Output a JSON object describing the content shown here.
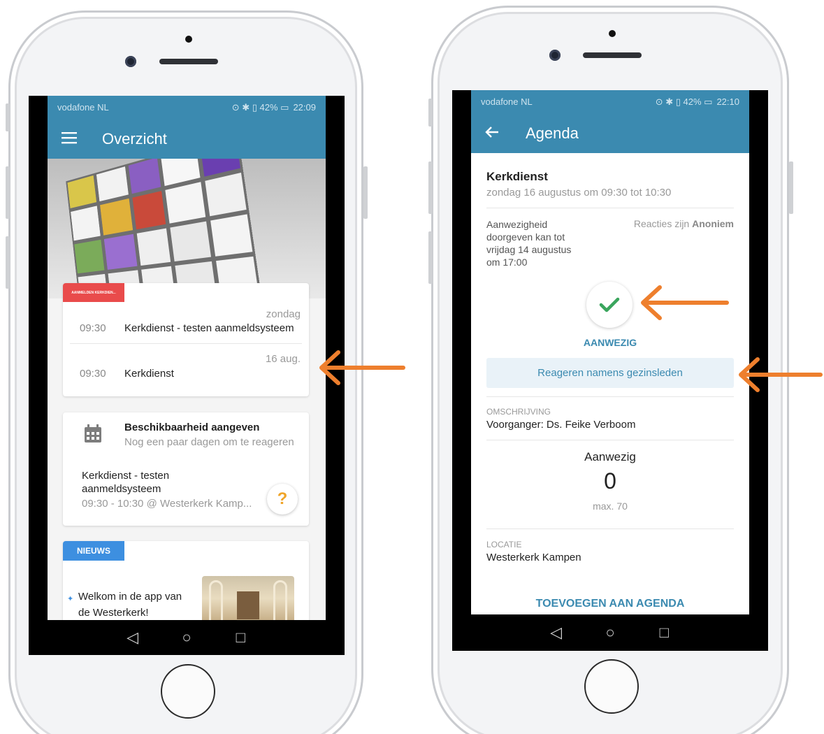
{
  "left_phone": {
    "status": {
      "carrier": "vodafone NL",
      "icons": "⊙ ✱ ▯ 42% ▭",
      "time": "22:09"
    },
    "appbar": {
      "menu_icon": "menu-icon",
      "title": "Overzicht"
    },
    "event_card": {
      "tag": "AANMELDEN KERKDIEN...",
      "rows": [
        {
          "date": "zondag",
          "time": "09:30",
          "title": "Kerkdienst - testen aanmeldsysteem"
        },
        {
          "date": "16 aug.",
          "time": "09:30",
          "title": "Kerkdienst"
        }
      ]
    },
    "availability_card": {
      "heading": "Beschikbaarheid aangeven",
      "subheading": "Nog een paar dagen om te reageren",
      "event_title_line1": "Kerkdienst - testen",
      "event_title_line2": "aanmeldsysteem",
      "event_meta": "09:30 - 10:30 @ Westerkerk Kamp...",
      "help_label": "?"
    },
    "news_card": {
      "tag": "NIEUWS",
      "pin_icon": "pin-icon",
      "title_line1": "Welkom in de app van",
      "title_line2": "de Westerkerk!"
    }
  },
  "right_phone": {
    "status": {
      "carrier": "vodafone NL",
      "icons": "⊙ ✱ ▯ 42% ▭",
      "time": "22:10"
    },
    "appbar": {
      "back_icon": "back-arrow-icon",
      "title": "Agenda"
    },
    "event": {
      "title": "Kerkdienst",
      "datetime": "zondag 16 augustus om 09:30 tot 10:30"
    },
    "attendance": {
      "deadline_line1": "Aanwezigheid",
      "deadline_line2": "doorgeven kan tot",
      "deadline_line3": "vrijdag 14 augustus",
      "deadline_line4": "om 17:00",
      "reactions_prefix": "Reacties zijn",
      "reactions_value": "Anoniem",
      "status_label": "AANWEZIG",
      "family_button": "Reageren namens gezinsleden"
    },
    "description": {
      "label": "OMSCHRIJVING",
      "value": "Voorganger: Ds. Feike Verboom"
    },
    "counter": {
      "label": "Aanwezig",
      "count": "0",
      "max": "max. 70"
    },
    "location": {
      "label": "LOCATIE",
      "value": "Westerkerk Kampen"
    },
    "add_to_agenda": "TOEVOEGEN AAN AGENDA"
  },
  "colors": {
    "primary": "#3b8ab0",
    "tag_red": "#e94b4b",
    "tag_blue": "#3d8fe0",
    "check_green": "#3aa55d",
    "arrow_orange": "#ee7f2d",
    "help_orange": "#f0a52a"
  }
}
